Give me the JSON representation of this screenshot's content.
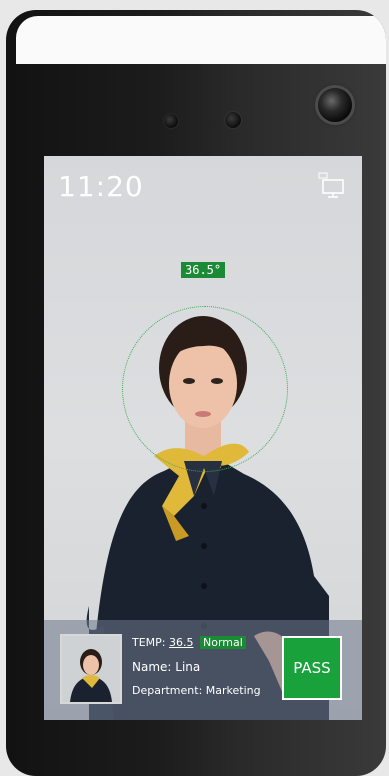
{
  "status_bar": {
    "time": "11:20",
    "network_icon": "monitor-network-icon"
  },
  "detection": {
    "temperature_reading": "36.5°"
  },
  "result_panel": {
    "temp_label": "TEMP:",
    "temp_value": "36.5",
    "temp_status": "Normal",
    "name_label": "Name:",
    "name_value": "Lina",
    "department_label": "Department:",
    "department_value": "Marketing",
    "pass_label": "PASS"
  },
  "colors": {
    "accent_green": "#1b8a34",
    "pass_green": "#19a23c"
  }
}
